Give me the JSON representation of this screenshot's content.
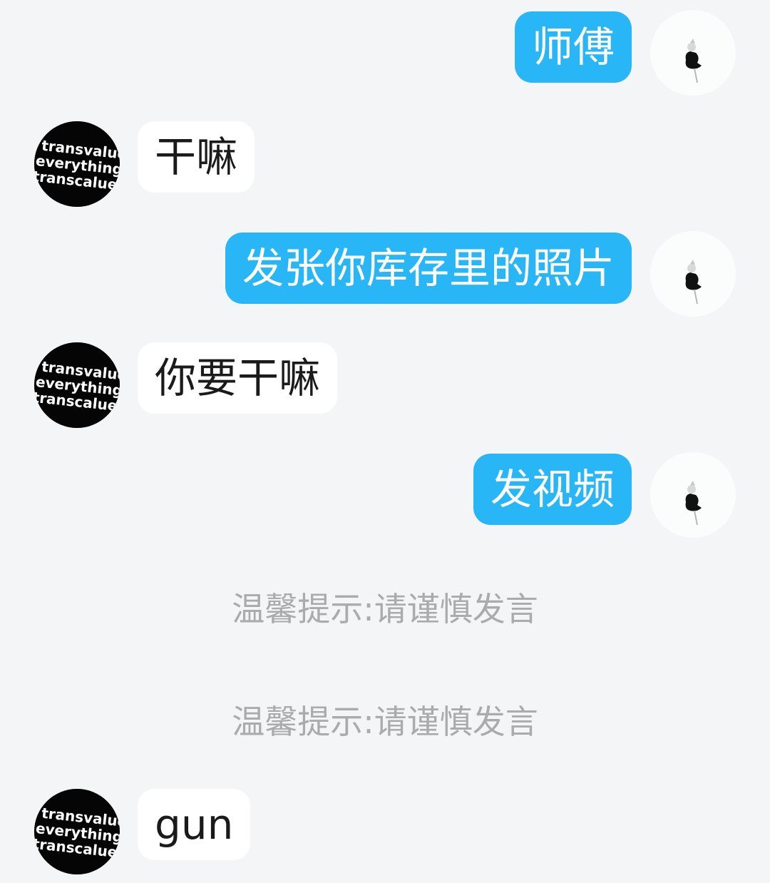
{
  "messages": [
    {
      "side": "me",
      "text": "师傅",
      "avatar": "user-avatar-icon"
    },
    {
      "side": "them",
      "text": "干嘛",
      "avatar": "contact-avatar-icon"
    },
    {
      "side": "me",
      "text": "发张你库存里的照片",
      "avatar": "user-avatar-icon"
    },
    {
      "side": "them",
      "text": "你要干嘛",
      "avatar": "contact-avatar-icon"
    },
    {
      "side": "me",
      "text": "发视频",
      "avatar": "user-avatar-icon"
    },
    {
      "side": "them",
      "text": "gun",
      "avatar": "contact-avatar-icon"
    }
  ],
  "system_tips": [
    "温馨提示:请谨慎发言",
    "温馨提示:请谨慎发言"
  ],
  "contact_avatar_text": [
    "transvalue",
    "everything",
    "transcalue"
  ],
  "colors": {
    "background": "#f4f5f7",
    "my_bubble": "#29b6f6",
    "their_bubble": "#ffffff",
    "tip_text": "#ababab"
  }
}
